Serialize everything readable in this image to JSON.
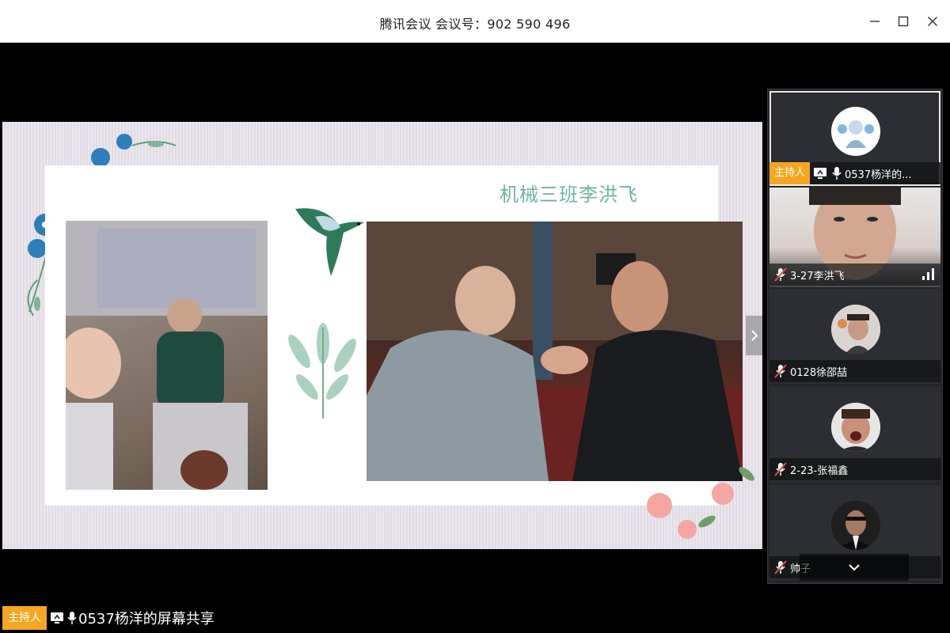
{
  "window": {
    "title": "腾讯会议 会议号：902 590 496",
    "controls": [
      "minimize",
      "maximize",
      "close"
    ]
  },
  "slide": {
    "title": "机械三班李洪飞",
    "accent_color": "#6fb3a6"
  },
  "bottom_bar": {
    "host_badge": "主持人",
    "share_label": "0537杨洋的屏幕共享"
  },
  "participants": [
    {
      "name": "0537杨洋的...",
      "host_badge": "主持人",
      "mic": "on",
      "sharing": true,
      "active": true
    },
    {
      "name": "3-27李洪飞",
      "mic": "muted",
      "video": true,
      "signal": "strong"
    },
    {
      "name": "0128徐邵喆",
      "mic": "muted"
    },
    {
      "name": "2-23-张福鑫",
      "mic": "muted"
    },
    {
      "name": "帅子",
      "mic": "muted"
    }
  ],
  "colors": {
    "host_badge": "#f5a623",
    "panel_bg": "#25262a",
    "muted": "#e04c4c"
  }
}
